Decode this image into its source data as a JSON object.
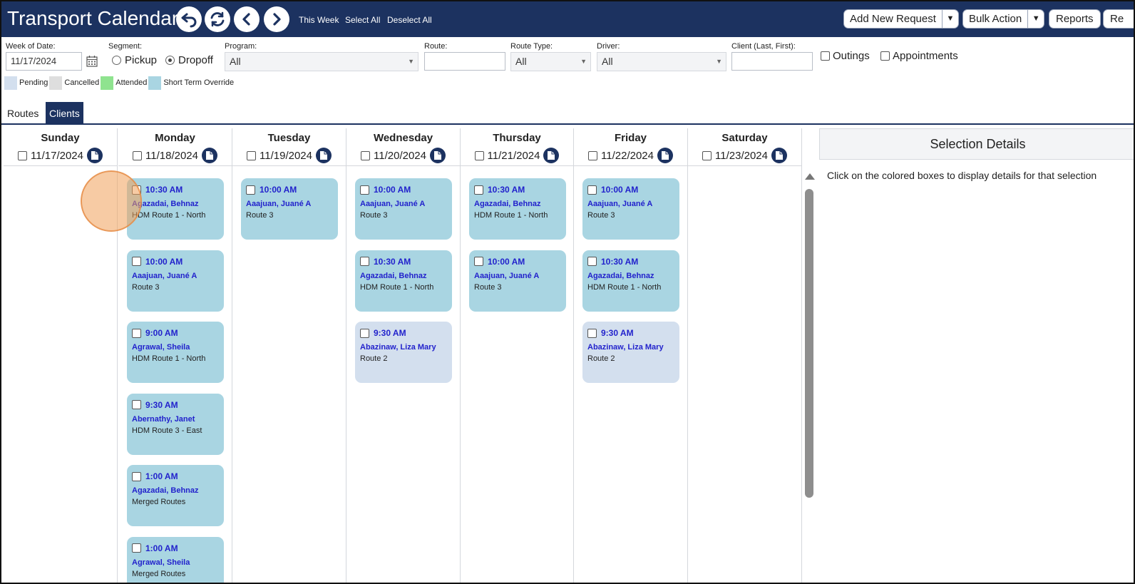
{
  "header": {
    "title": "Transport Calendar",
    "links": {
      "this_week": "This Week",
      "select_all": "Select All",
      "deselect_all": "Deselect All"
    },
    "buttons": {
      "add_new_request": "Add New Request",
      "bulk_action": "Bulk Action",
      "reports": "Reports",
      "cut_off": "Re"
    },
    "icons": [
      "undo-icon",
      "refresh-icon",
      "chevron-left-icon",
      "chevron-right-icon"
    ]
  },
  "filters": {
    "week_of_date": {
      "label": "Week of Date:",
      "value": "11/17/2024"
    },
    "segment": {
      "label": "Segment:",
      "pickup": "Pickup",
      "dropoff": "Dropoff",
      "selected": "Dropoff"
    },
    "program": {
      "label": "Program:",
      "value": "All"
    },
    "route": {
      "label": "Route:",
      "value": ""
    },
    "route_type": {
      "label": "Route Type:",
      "value": "All"
    },
    "driver": {
      "label": "Driver:",
      "value": "All"
    },
    "client": {
      "label": "Client (Last, First):",
      "value": ""
    },
    "outings": "Outings",
    "appointments": "Appointments"
  },
  "legend": [
    {
      "label": "Pending",
      "color": "#d3dfee"
    },
    {
      "label": "Cancelled",
      "color": "#dedede"
    },
    {
      "label": "Attended",
      "color": "#8fe38f"
    },
    {
      "label": "Short Term Override",
      "color": "#a9d5e2"
    }
  ],
  "tabs": [
    {
      "label": "Routes",
      "active": false
    },
    {
      "label": "Clients",
      "active": true
    }
  ],
  "days": [
    {
      "name": "Sunday",
      "date": "11/17/2024",
      "appointments": []
    },
    {
      "name": "Monday",
      "date": "11/18/2024",
      "appointments": [
        {
          "time": "10:30 AM",
          "client": "Agazadai, Behnaz",
          "route": "HDM Route 1 - North",
          "status": "override"
        },
        {
          "time": "10:00 AM",
          "client": "Aaajuan, Juané A",
          "route": "Route 3",
          "status": "override"
        },
        {
          "time": "9:00 AM",
          "client": "Agrawal, Sheila",
          "route": "HDM Route 1 - North",
          "status": "override"
        },
        {
          "time": "9:30 AM",
          "client": "Abernathy, Janet",
          "route": "HDM Route 3 - East",
          "status": "override"
        },
        {
          "time": "1:00 AM",
          "client": "Agazadai, Behnaz",
          "route": "Merged Routes",
          "status": "override"
        },
        {
          "time": "1:00 AM",
          "client": "Agrawal, Sheila",
          "route": "Merged Routes",
          "status": "override"
        }
      ]
    },
    {
      "name": "Tuesday",
      "date": "11/19/2024",
      "appointments": [
        {
          "time": "10:00 AM",
          "client": "Aaajuan, Juané A",
          "route": "Route 3",
          "status": "override"
        }
      ]
    },
    {
      "name": "Wednesday",
      "date": "11/20/2024",
      "appointments": [
        {
          "time": "10:00 AM",
          "client": "Aaajuan, Juané A",
          "route": "Route 3",
          "status": "override"
        },
        {
          "time": "10:30 AM",
          "client": "Agazadai, Behnaz",
          "route": "HDM Route 1 - North",
          "status": "override"
        },
        {
          "time": "9:30 AM",
          "client": "Abazinaw, Liza Mary",
          "route": "Route 2",
          "status": "pending"
        }
      ]
    },
    {
      "name": "Thursday",
      "date": "11/21/2024",
      "appointments": [
        {
          "time": "10:30 AM",
          "client": "Agazadai, Behnaz",
          "route": "HDM Route 1 - North",
          "status": "override"
        },
        {
          "time": "10:00 AM",
          "client": "Aaajuan, Juané A",
          "route": "Route 3",
          "status": "override"
        }
      ]
    },
    {
      "name": "Friday",
      "date": "11/22/2024",
      "appointments": [
        {
          "time": "10:00 AM",
          "client": "Aaajuan, Juané A",
          "route": "Route 3",
          "status": "override"
        },
        {
          "time": "10:30 AM",
          "client": "Agazadai, Behnaz",
          "route": "HDM Route 1 - North",
          "status": "override"
        },
        {
          "time": "9:30 AM",
          "client": "Abazinaw, Liza Mary",
          "route": "Route 2",
          "status": "pending"
        }
      ]
    },
    {
      "name": "Saturday",
      "date": "11/23/2024",
      "appointments": []
    }
  ],
  "details": {
    "title": "Selection Details",
    "message": "Click on the colored boxes to display details for that selection"
  }
}
